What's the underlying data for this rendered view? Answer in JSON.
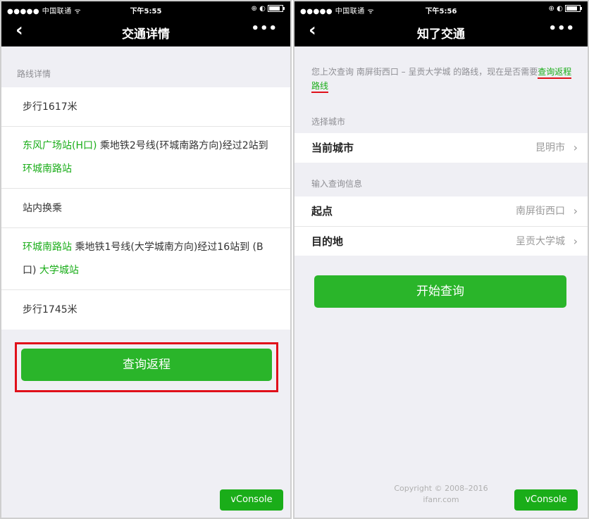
{
  "left": {
    "status": {
      "carrier": "●●●●● 中国联通 ᯤ",
      "time": "下午5:55",
      "icons": "⊕ ◐"
    },
    "nav": {
      "back": "‹",
      "title": "交通详情",
      "more": "•••"
    },
    "section_label": "路线详情",
    "steps": [
      {
        "text": "步行1617米"
      },
      {
        "from": "东风广场站(H口)",
        "middle": " 乘地铁2号线(环城南路方向)经过2站到 ",
        "to": "环城南路站"
      },
      {
        "text": "站内换乘"
      },
      {
        "from": "环城南路站",
        "middle": " 乘地铁1号线(大学城南方向)经过16站到 (B口) ",
        "to": "大学城站"
      },
      {
        "text": "步行1745米"
      }
    ],
    "return_button": "查询返程",
    "vconsole": "vConsole"
  },
  "right": {
    "status": {
      "carrier": "●●●●● 中国联通 ᯤ",
      "time": "下午5:56",
      "icons": "⊕ ◐"
    },
    "nav": {
      "back": "‹",
      "title": "知了交通",
      "more": "•••"
    },
    "info_text": "您上次查询 南屏街西口 – 呈贡大学城 的路线，现在是否需要",
    "info_link": "查询返程路线",
    "city_section_label": "选择城市",
    "city": {
      "label": "当前城市",
      "value": "昆明市"
    },
    "query_section_label": "输入查询信息",
    "start": {
      "label": "起点",
      "value": "南屏街西口"
    },
    "destination": {
      "label": "目的地",
      "value": "呈贡大学城"
    },
    "start_button": "开始查询",
    "copyright_line1": "Copyright © 2008–2016",
    "copyright_line2": "ifanr.com",
    "vconsole": "vConsole",
    "chevron": "›"
  },
  "colors": {
    "accent_green": "#1aad19",
    "highlight_red": "#e0101a",
    "nav_black": "#000000"
  }
}
